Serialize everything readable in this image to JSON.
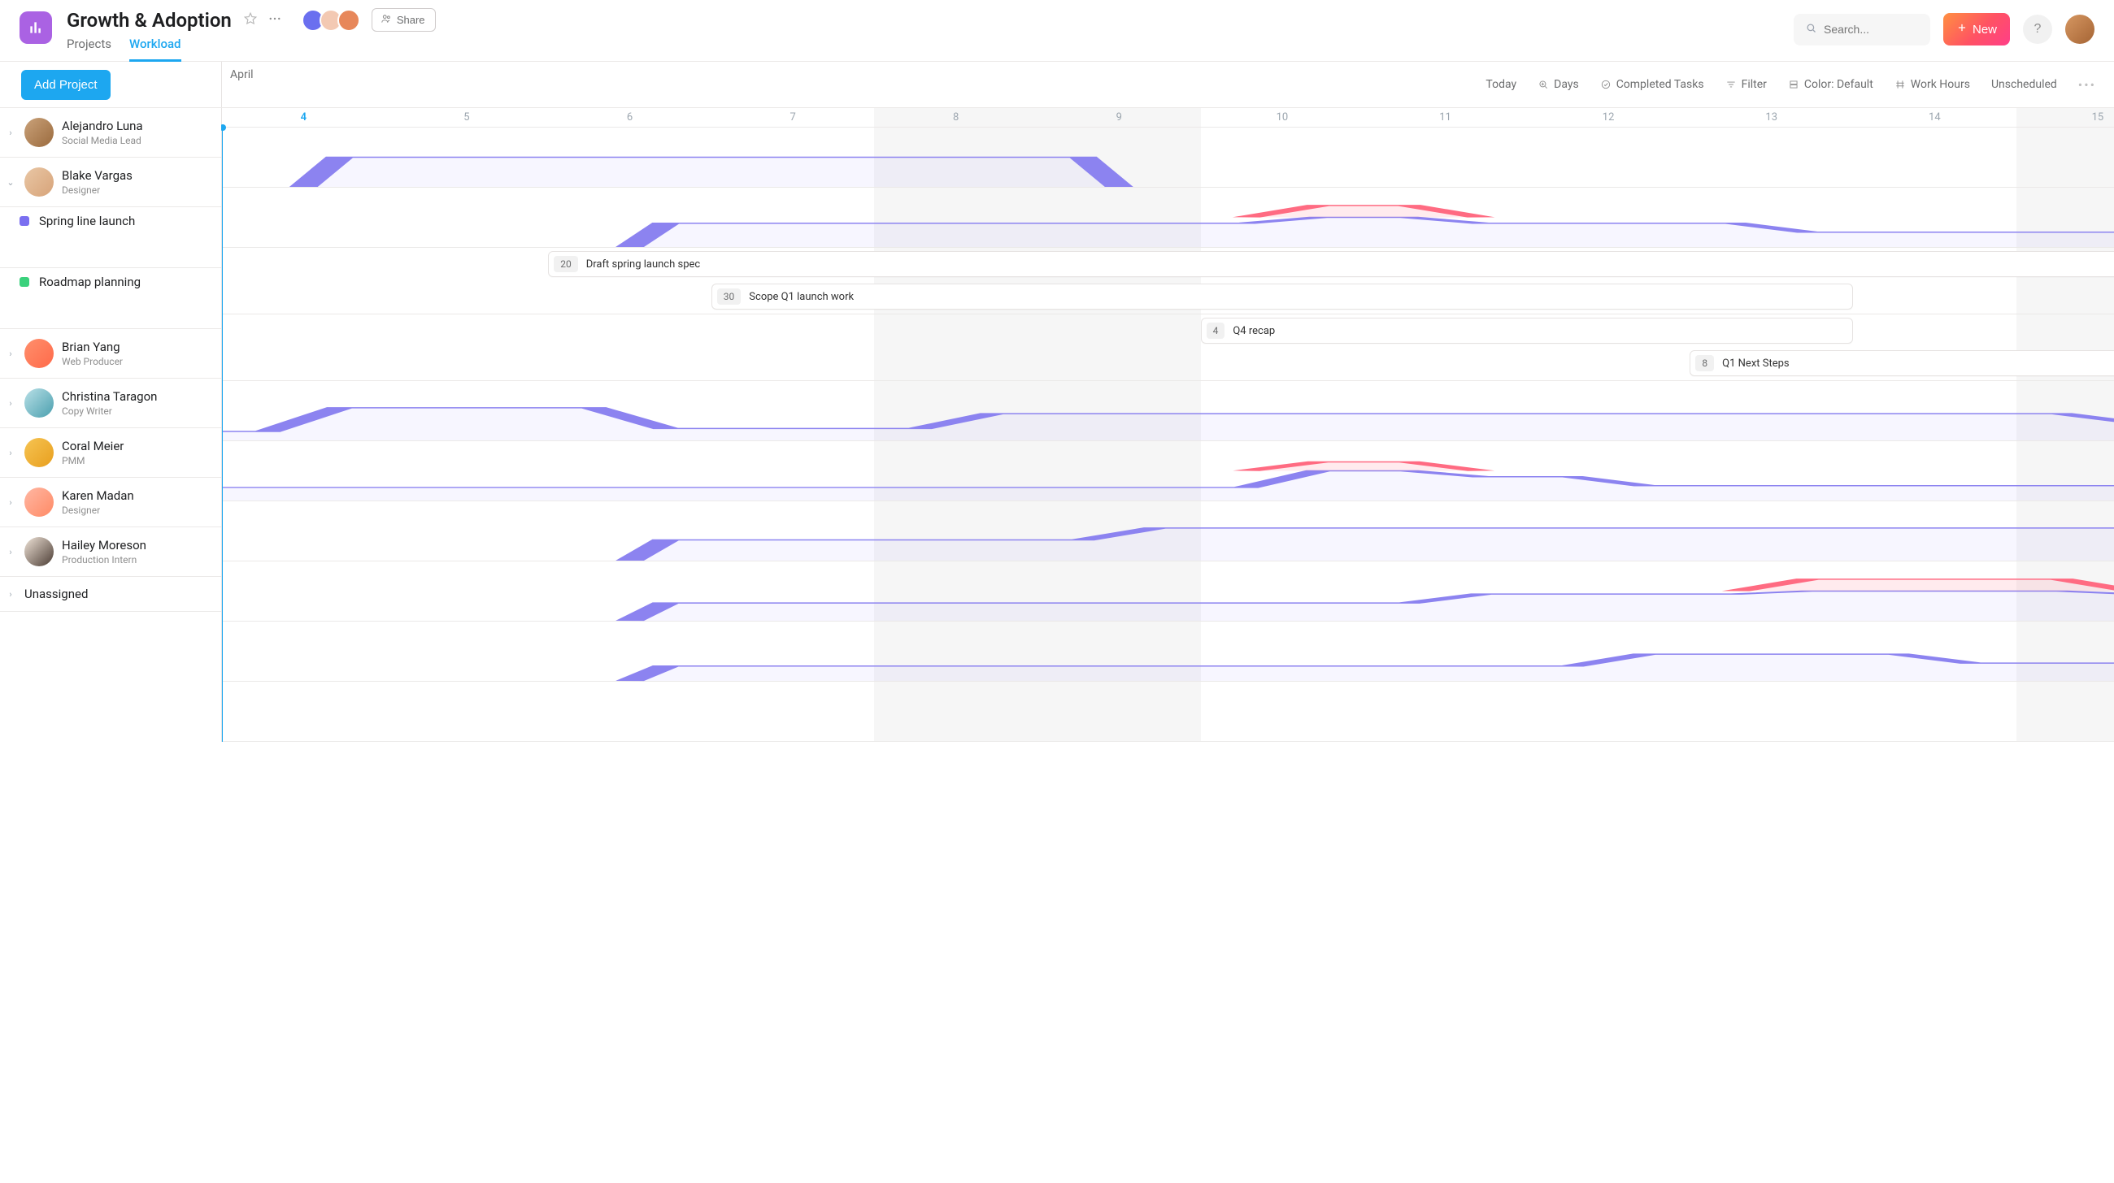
{
  "workspace": {
    "title": "Growth & Adoption",
    "tabs": [
      "Projects",
      "Workload"
    ],
    "active_tab": 1,
    "share_label": "Share",
    "collaborator_colors": [
      "#6a6fef",
      "#f3c9b3",
      "#e7875a"
    ]
  },
  "topbar": {
    "search_placeholder": "Search...",
    "new_label": "New",
    "help_label": "?"
  },
  "toolbar": {
    "add_project_label": "Add Project",
    "month_label": "April",
    "items": {
      "today": "Today",
      "zoom": "Days",
      "completed": "Completed Tasks",
      "filter": "Filter",
      "color": "Color: Default",
      "work_hours": "Work Hours",
      "unscheduled": "Unscheduled"
    }
  },
  "timeline": {
    "start_day": 3.5,
    "end_day": 15.1,
    "current_day": 4,
    "days": [
      {
        "n": 4,
        "label": "4"
      },
      {
        "n": 5,
        "label": "5"
      },
      {
        "n": 6,
        "label": "6"
      },
      {
        "n": 7,
        "label": "7"
      },
      {
        "n": 8,
        "label": "8",
        "weekend": true
      },
      {
        "n": 9,
        "label": "9",
        "weekend": true
      },
      {
        "n": 10,
        "label": "10"
      },
      {
        "n": 11,
        "label": "11"
      },
      {
        "n": 12,
        "label": "12"
      },
      {
        "n": 13,
        "label": "13"
      },
      {
        "n": 14,
        "label": "14"
      },
      {
        "n": 15,
        "label": "15",
        "weekend": true
      }
    ]
  },
  "people": [
    {
      "id": "p0",
      "name": "Alejandro Luna",
      "role": "Social Media Lead",
      "avatar_bg": "linear-gradient(135deg,#caa27a,#9a6a3d)",
      "expanded": false,
      "workload": {
        "span": [
          4,
          9
        ],
        "segments": [
          {
            "level": 0.5,
            "range": [
              4,
              9
            ]
          }
        ]
      }
    },
    {
      "id": "p1",
      "name": "Blake Vargas",
      "role": "Designer",
      "avatar_bg": "linear-gradient(135deg,#e9c7a5,#d7a379)",
      "expanded": true,
      "workload": {
        "span": [
          6,
          15.1
        ],
        "segments": [
          {
            "level": 0.4,
            "range": [
              6,
              10
            ]
          },
          {
            "level": 0.7,
            "range": [
              10,
              11
            ],
            "over": true
          },
          {
            "level": 0.4,
            "range": [
              11,
              13
            ]
          },
          {
            "level": 0.25,
            "range": [
              13,
              15.1
            ]
          }
        ]
      },
      "projects": [
        {
          "name": "Spring line launch",
          "color": "#7a6ff0",
          "tasks": [
            {
              "label": "Draft spring launch spec",
              "badge": "20",
              "range": [
                6,
                15.1
              ]
            },
            {
              "label": "Scope Q1 launch work",
              "badge": "30",
              "range": [
                7,
                13
              ]
            }
          ]
        },
        {
          "name": "Roadmap planning",
          "color": "#3ad17c",
          "tasks": [
            {
              "label": "Q4 recap",
              "badge": "4",
              "range": [
                10,
                13
              ]
            },
            {
              "label": "Q1 Next Steps",
              "badge": "8",
              "range": [
                13,
                15.1
              ]
            }
          ]
        }
      ]
    },
    {
      "id": "p2",
      "name": "Brian Yang",
      "role": "Web Producer",
      "avatar_bg": "linear-gradient(135deg,#ff8f6c,#ff6a4a)",
      "expanded": false,
      "workload": {
        "span": [
          3.5,
          15.1
        ],
        "segments": [
          {
            "level": 0.15,
            "range": [
              3.5,
              4
            ]
          },
          {
            "level": 0.55,
            "range": [
              4,
              6
            ]
          },
          {
            "level": 0.2,
            "range": [
              6,
              8
            ]
          },
          {
            "level": 0.45,
            "range": [
              8,
              15
            ]
          },
          {
            "level": 0.3,
            "range": [
              15,
              15.1
            ]
          }
        ]
      }
    },
    {
      "id": "p3",
      "name": "Christina Taragon",
      "role": "Copy Writer",
      "avatar_bg": "linear-gradient(135deg,#b9e0e7,#4a9fae)",
      "expanded": false,
      "workload": {
        "span": [
          3.5,
          15.1
        ],
        "segments": [
          {
            "level": 0.22,
            "range": [
              3.5,
              10
            ]
          },
          {
            "level": 0.65,
            "range": [
              10,
              11
            ],
            "over": true
          },
          {
            "level": 0.4,
            "range": [
              11,
              12
            ]
          },
          {
            "level": 0.25,
            "range": [
              12,
              15.1
            ]
          }
        ]
      }
    },
    {
      "id": "p4",
      "name": "Coral Meier",
      "role": "PMM",
      "avatar_bg": "linear-gradient(135deg,#f6c453,#e89f1e)",
      "expanded": false,
      "workload": {
        "span": [
          6,
          15.1
        ],
        "segments": [
          {
            "level": 0.35,
            "range": [
              6,
              9
            ]
          },
          {
            "level": 0.55,
            "range": [
              9,
              15.1
            ]
          }
        ]
      }
    },
    {
      "id": "p5",
      "name": "Karen Madan",
      "role": "Designer",
      "avatar_bg": "linear-gradient(135deg,#ffb7a3,#ff8a65)",
      "expanded": false,
      "workload": {
        "span": [
          6,
          15.1
        ],
        "segments": [
          {
            "level": 0.3,
            "range": [
              6,
              11
            ]
          },
          {
            "level": 0.45,
            "range": [
              11,
              13
            ]
          },
          {
            "level": 0.7,
            "range": [
              13,
              15
            ],
            "over": true
          },
          {
            "level": 0.45,
            "range": [
              15,
              15.1
            ]
          }
        ]
      }
    },
    {
      "id": "p6",
      "name": "Hailey Moreson",
      "role": "Production Intern",
      "avatar_bg": "linear-gradient(135deg,#f0e4d8,#4a3b33)",
      "expanded": false,
      "workload": {
        "span": [
          6,
          15.1
        ],
        "segments": [
          {
            "level": 0.25,
            "range": [
              6,
              12
            ]
          },
          {
            "level": 0.45,
            "range": [
              12,
              14
            ]
          },
          {
            "level": 0.3,
            "range": [
              14,
              15.1
            ]
          }
        ]
      }
    }
  ],
  "unassigned_label": "Unassigned"
}
